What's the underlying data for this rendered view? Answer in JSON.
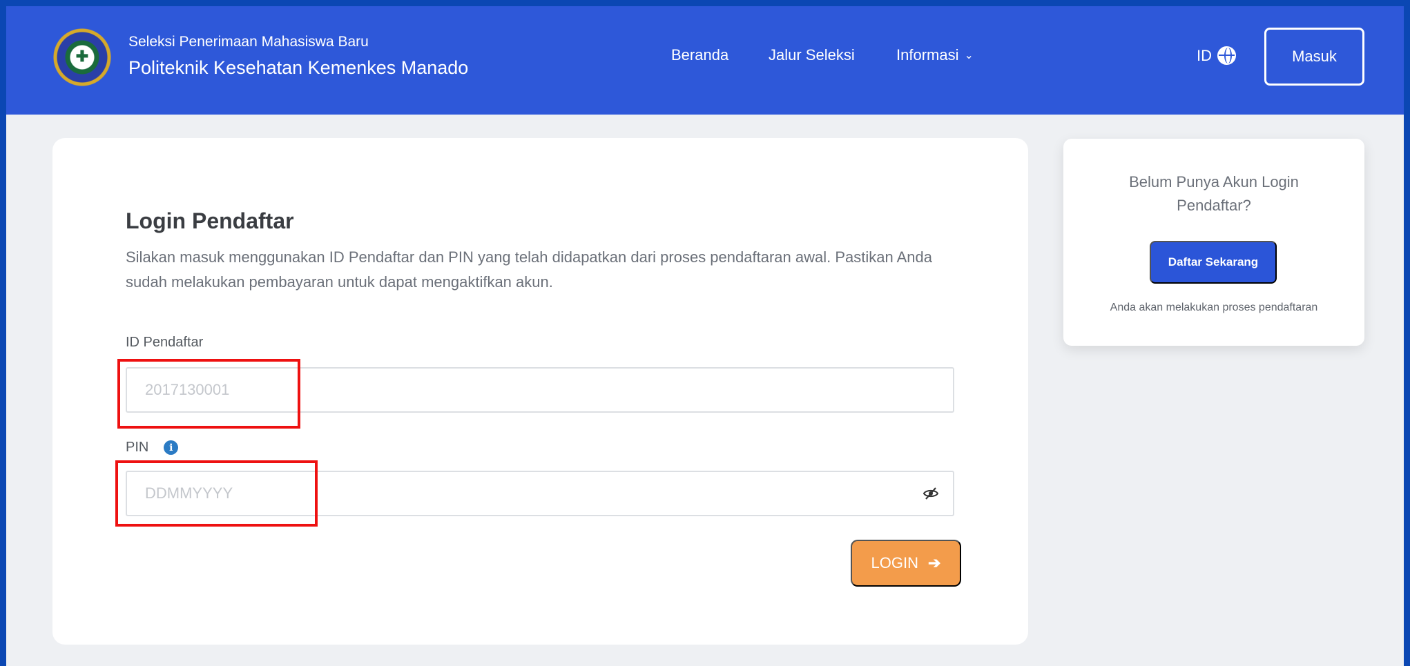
{
  "header": {
    "subtitle": "Seleksi Penerimaan Mahasiswa Baru",
    "title": "Politeknik Kesehatan Kemenkes Manado",
    "nav": [
      {
        "label": "Beranda"
      },
      {
        "label": "Jalur Seleksi"
      },
      {
        "label": "Informasi",
        "icon": "chevron-down-icon"
      }
    ],
    "lang": {
      "label": "ID",
      "icon": "globe-icon"
    },
    "masuk_label": "Masuk"
  },
  "login": {
    "title": "Login Pendaftar",
    "description": "Silakan masuk menggunakan ID Pendaftar dan PIN yang telah didapatkan dari proses pendaftaran awal. Pastikan Anda sudah melakukan pembayaran untuk dapat mengaktifkan akun.",
    "id_label": "ID Pendaftar",
    "id_placeholder": "2017130001",
    "id_value": "",
    "pin_label": "PIN",
    "pin_placeholder": "DDMMYYYY",
    "pin_value": "",
    "button_label": "LOGIN"
  },
  "side": {
    "question": "Belum Punya Akun Login Pendaftar?",
    "button_label": "Daftar Sekarang",
    "note": "Anda akan melakukan proses pendaftaran"
  },
  "colors": {
    "navbar": "#2e58d9",
    "login_button": "#f39c4b",
    "primary_button": "#2b55d8",
    "highlight": "#ee1111"
  }
}
